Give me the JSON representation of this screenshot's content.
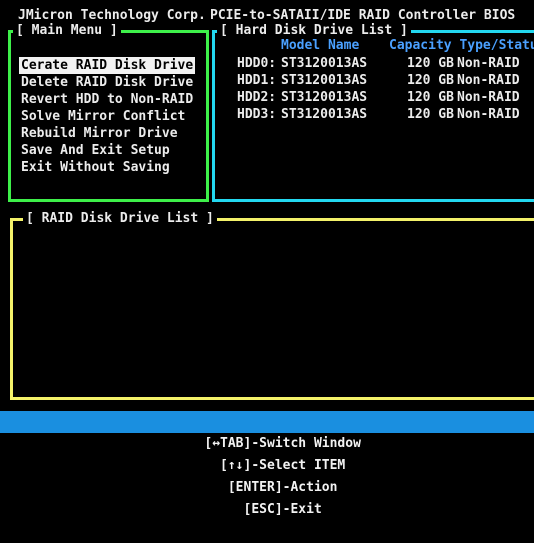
{
  "header": {
    "vendor": "JMicron Technology Corp.",
    "product": "PCIE-to-SATAII/IDE RAID Controller BIOS"
  },
  "main_menu": {
    "title": "[ Main Menu ]",
    "selected_index": 0,
    "items": [
      "Cerate RAID Disk Drive",
      "Delete RAID Disk Drive",
      "Revert HDD to Non-RAID",
      "Solve Mirror Conflict",
      "Rebuild Mirror Drive",
      "Save And Exit Setup",
      "Exit Without Saving"
    ]
  },
  "hdd_list": {
    "title": "[ Hard Disk Drive List ]",
    "headers": {
      "model": "Model Name",
      "capacity_type": "Capacity Type/Status"
    },
    "rows": [
      {
        "id": "HDD0:",
        "model": "ST3120013AS",
        "capacity": "120 GB",
        "status": "Non-RAID"
      },
      {
        "id": "HDD1:",
        "model": "ST3120013AS",
        "capacity": "120 GB",
        "status": "Non-RAID"
      },
      {
        "id": "HDD2:",
        "model": "ST3120013AS",
        "capacity": "120 GB",
        "status": "Non-RAID"
      },
      {
        "id": "HDD3:",
        "model": "ST3120013AS",
        "capacity": "120 GB",
        "status": "Non-RAID"
      }
    ]
  },
  "raid_list": {
    "title": "[ RAID Disk Drive List ]"
  },
  "status_bar": {
    "switch_window": "[↔TAB]-Switch Window",
    "select_item": "[↑↓]-Select ITEM",
    "action": "[ENTER]-Action",
    "exit": "[ESC]-Exit"
  },
  "colors": {
    "background": "#000000",
    "main_menu_border": "#3ef04a",
    "hdd_border": "#23d8f0",
    "raid_border": "#f4f26a",
    "header_text": "#4aa0ff",
    "status_bar": "#1a8fe0"
  }
}
